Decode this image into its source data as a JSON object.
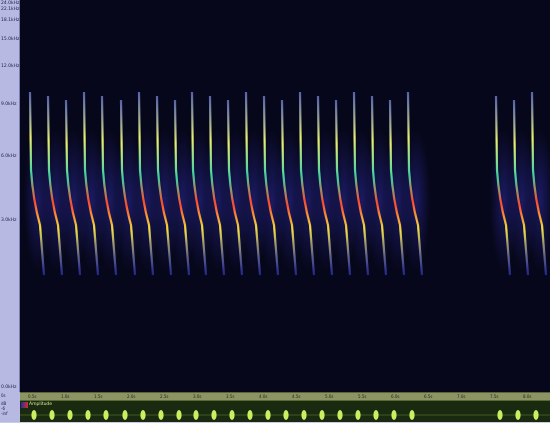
{
  "ruler": {
    "ticks": [
      "24.0kHz",
      "22.1kHz",
      "18.1kHz",
      "15.0kHz",
      "12.0kHz",
      "9.0kHz",
      "6.0kHz",
      "3.0kHz",
      "0.0kHz"
    ]
  },
  "timebar": {
    "labels": [
      "0.5s",
      "1.0s",
      "1.5s",
      "2.0s",
      "2.5s",
      "3.0s",
      "3.5s",
      "4.0s",
      "4.5s",
      "5.0s",
      "5.5s",
      "6.0s",
      "6.5s",
      "7.0s",
      "7.5s",
      "8.0s"
    ]
  },
  "corner": {
    "label": "0s"
  },
  "waveform": {
    "label": "Amplitude"
  },
  "wave_left": {
    "line1": "dB",
    "line2": "-6",
    "line3": "-inf"
  },
  "colors": {
    "background": "#07071c",
    "call_hot": "#ff3a2a",
    "call_mid": "#f2e43a",
    "call_cool": "#3a4cff",
    "wave": "#c8f060"
  }
}
